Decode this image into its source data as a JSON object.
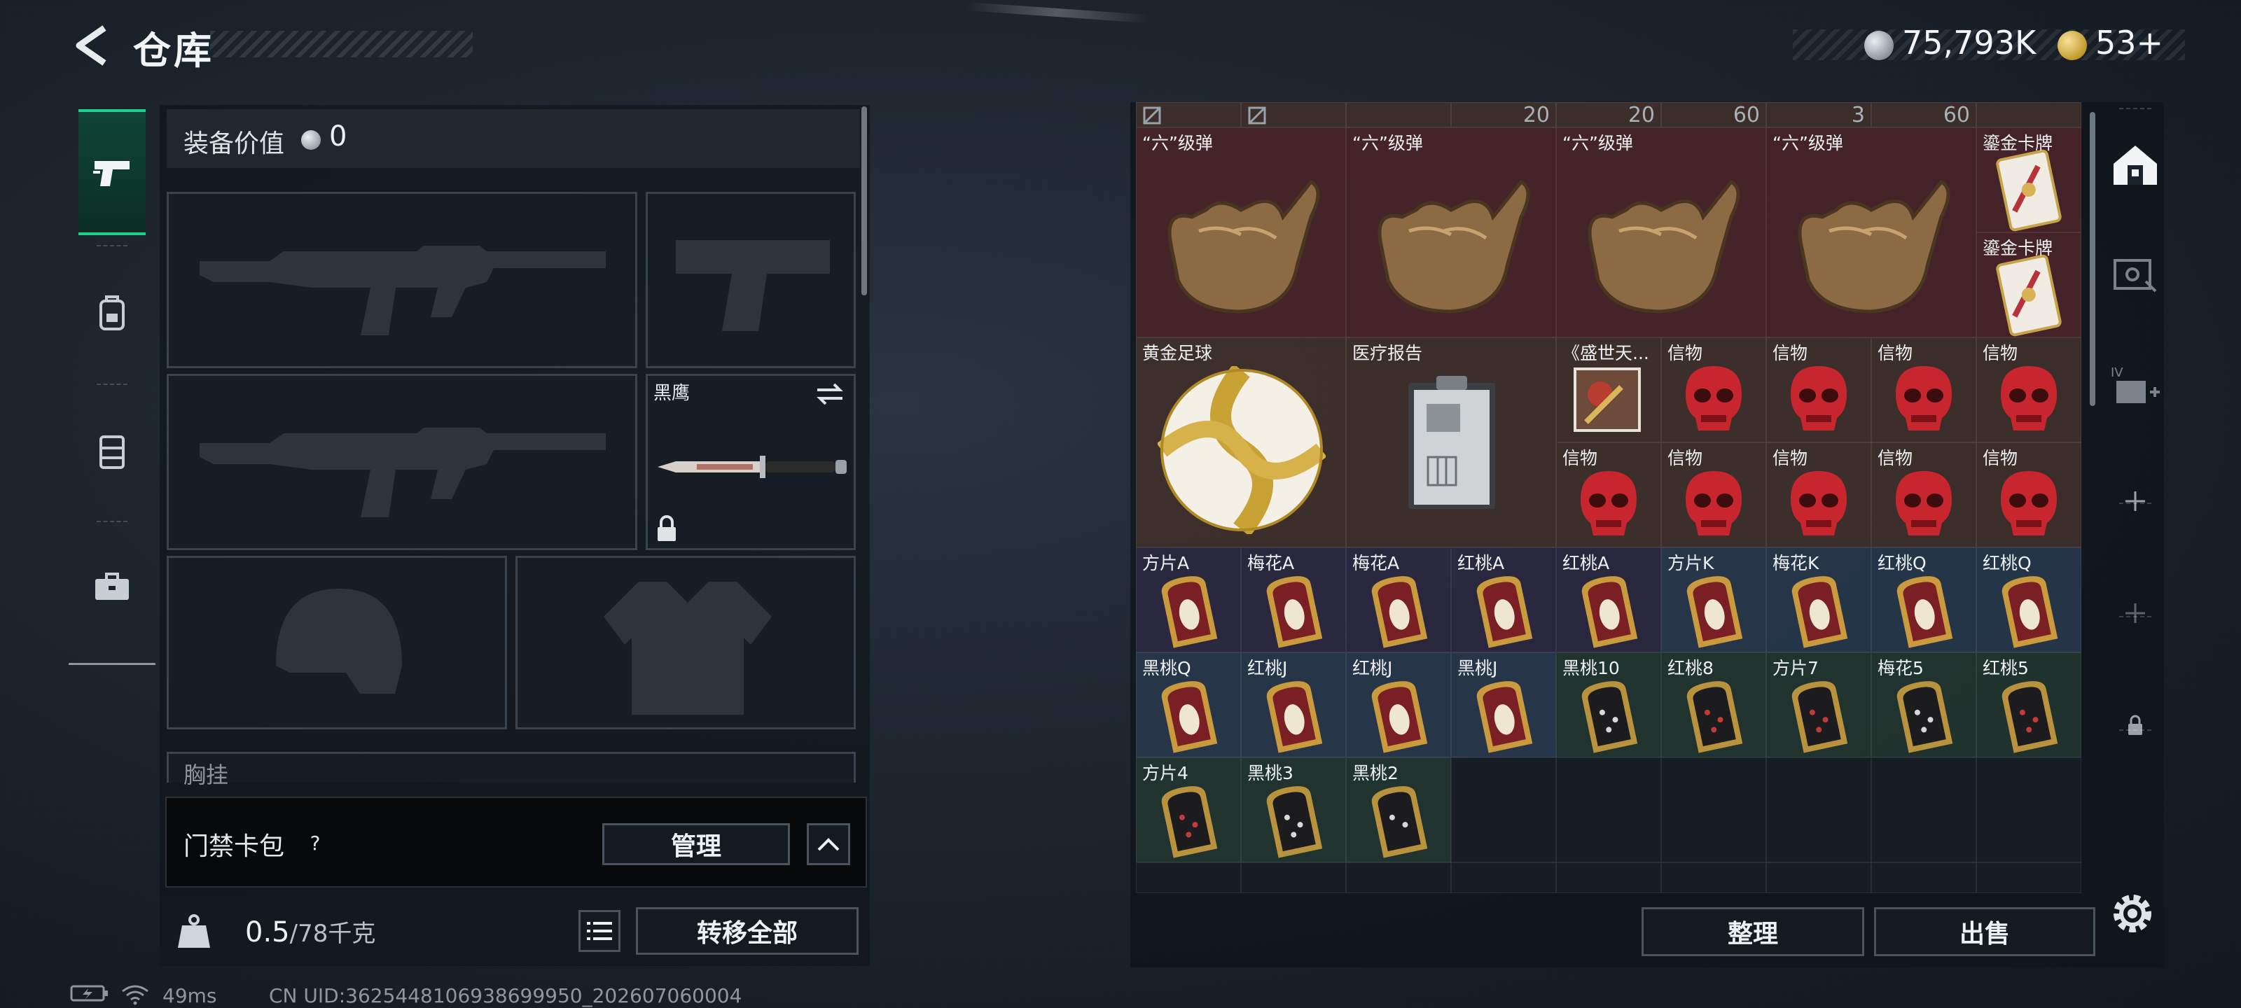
{
  "header": {
    "title": "仓库",
    "currency": {
      "silver": "75,793K",
      "gold": "53+"
    }
  },
  "equipment": {
    "value_label": "装备价值",
    "value": "0",
    "knife_slot_label": "黑鹰",
    "chest_label": "胸挂",
    "keycard_label": "门禁卡包",
    "help_glyph": "?",
    "manage_label": "管理",
    "weight": "0.5",
    "weight_max": "/78千克",
    "transfer_all_label": "转移全部"
  },
  "storage": {
    "top_counts": [
      "20",
      "20",
      "60",
      "3",
      "60"
    ],
    "row1": [
      {
        "label": "“六”级弹"
      },
      {
        "label": "“六”级弹"
      },
      {
        "label": "“六”级弹"
      },
      {
        "label": "“六”级弹"
      },
      {
        "label": "鎏金卡牌"
      },
      {
        "label": "鎏金卡牌"
      }
    ],
    "row2": [
      {
        "label": "黄金足球"
      },
      {
        "label": "医疗报告"
      },
      {
        "label": "《盛世天..."
      },
      {
        "label": "信物"
      },
      {
        "label": "信物"
      },
      {
        "label": "信物"
      },
      {
        "label": "信物"
      },
      {
        "label": "信物"
      },
      {
        "label": "信物"
      },
      {
        "label": "信物"
      },
      {
        "label": "信物"
      },
      {
        "label": "信物"
      }
    ],
    "row_cards1": [
      "方片A",
      "梅花A",
      "梅花A",
      "红桃A",
      "红桃A",
      "方片K",
      "梅花K",
      "红桃Q",
      "红桃Q"
    ],
    "row_cards2": [
      "黑桃Q",
      "红桃J",
      "红桃J",
      "黑桃J",
      "黑桃10",
      "红桃8",
      "方片7",
      "梅花5",
      "红桃5"
    ],
    "row_cards3": [
      "方片4",
      "黑桃3",
      "黑桃2"
    ],
    "sort_label": "整理",
    "sell_label": "出售"
  },
  "status_bar": {
    "ping": "49ms",
    "uid": "CN UID:3625448106938699950_202607060004"
  },
  "colors": {
    "accent_green": "#1fd08b",
    "panel_bg": "#10151b"
  }
}
